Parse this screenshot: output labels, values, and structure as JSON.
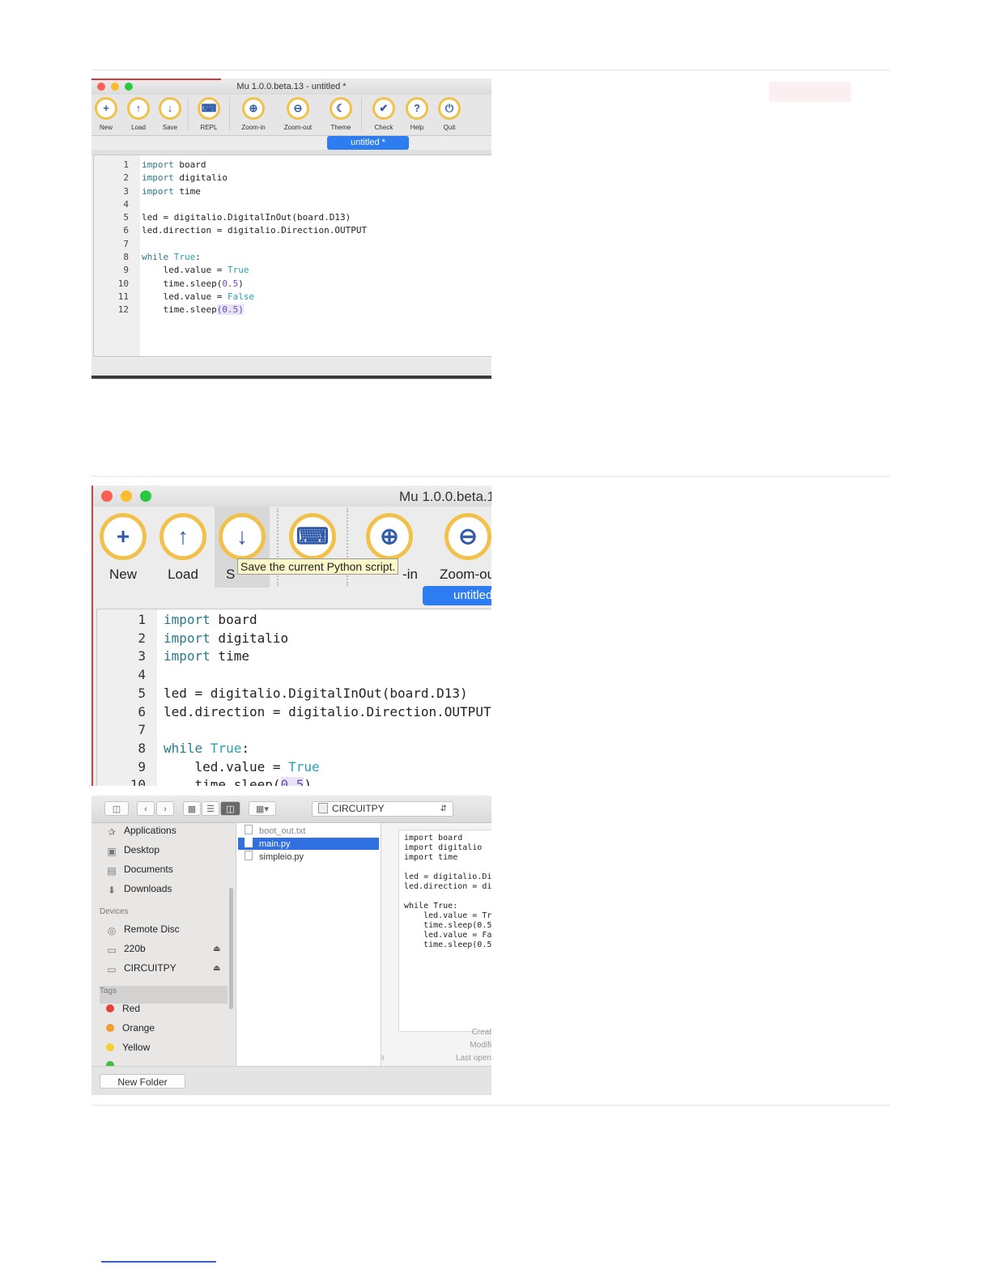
{
  "shot1": {
    "window_title": "Mu 1.0.0.beta.13 - untitled *",
    "toolbar": [
      {
        "label": "New",
        "icon": "plus-icon"
      },
      {
        "label": "Load",
        "icon": "upload-icon"
      },
      {
        "label": "Save",
        "icon": "download-icon"
      },
      {
        "label": "REPL",
        "icon": "keyboard-icon"
      },
      {
        "label": "Zoom-in",
        "icon": "zoom-in-icon"
      },
      {
        "label": "Zoom-out",
        "icon": "zoom-out-icon"
      },
      {
        "label": "Theme",
        "icon": "moon-icon"
      },
      {
        "label": "Check",
        "icon": "thumbs-up-icon"
      },
      {
        "label": "Help",
        "icon": "question-icon"
      },
      {
        "label": "Quit",
        "icon": "power-icon"
      }
    ],
    "tab": "untitled *",
    "line_numbers": [
      "1",
      "2",
      "3",
      "4",
      "5",
      "6",
      "7",
      "8",
      "9",
      "10",
      "11",
      "12"
    ],
    "code": {
      "l1a": "import",
      "l1b": " board",
      "l2a": "import",
      "l2b": " digitalio",
      "l3a": "import",
      "l3b": " time",
      "l5": "led = digitalio.DigitalInOut(board.D13)",
      "l6": "led.direction = digitalio.Direction.OUTPUT",
      "l8a": "while",
      "l8b": " True",
      "l8c": ":",
      "l9a": "    led.value = ",
      "l9b": "True",
      "l10a": "    time.sleep(",
      "l10b": "0.5",
      "l10c": ")",
      "l11a": "    led.value = ",
      "l11b": "False",
      "l12a": "    time.sleep",
      "l12b": "(0.5)"
    }
  },
  "shot2": {
    "window_title": "Mu 1.0.0.beta.13",
    "toolbar": [
      {
        "label": "New",
        "icon": "plus-icon"
      },
      {
        "label": "Load",
        "icon": "upload-icon"
      },
      {
        "label": "S",
        "icon": "download-icon"
      },
      {
        "label": "",
        "icon": "keyboard-icon"
      },
      {
        "label": "-in",
        "icon": "zoom-in-icon"
      },
      {
        "label": "Zoom-ou",
        "icon": "zoom-out-icon"
      }
    ],
    "tooltip": "Save the current Python script.",
    "tab": "untitled",
    "line_numbers": [
      "1",
      "2",
      "3",
      "4",
      "5",
      "6",
      "7",
      "8",
      "9",
      "10"
    ],
    "code": {
      "l1a": "import",
      "l1b": " board",
      "l2a": "import",
      "l2b": " digitalio",
      "l3a": "import",
      "l3b": " time",
      "l5": "led = digitalio.DigitalInOut(board.D13)",
      "l6": "led.direction = digitalio.Direction.OUTPUT",
      "l8a": "while",
      "l8b": " True",
      "l8c": ":",
      "l9a": "    led.value = ",
      "l9b": "True",
      "l10a": "    time.sleep(",
      "l10b": "0.5",
      "l10c": ")"
    }
  },
  "shot3": {
    "path": "CIRCUITPY",
    "sidebar": {
      "favorites": [
        "Applications",
        "Desktop",
        "Documents",
        "Downloads"
      ],
      "devices_header": "Devices",
      "devices": [
        "Remote Disc",
        "220b",
        "CIRCUITPY"
      ],
      "tags_header": "Tags",
      "tags": [
        {
          "name": "Red",
          "color": "#e8403a"
        },
        {
          "name": "Orange",
          "color": "#f39c2b"
        },
        {
          "name": "Yellow",
          "color": "#f5cf2e"
        }
      ]
    },
    "files": [
      "boot_out.txt",
      "main.py",
      "simpleio.py"
    ],
    "selected_file": "main.py",
    "preview_text": "import board\nimport digitalio\nimport time\n\nled = digitalio.Di\nled.direction = di\n\nwhile True:\n    led.value = Tr\n    time.sleep(0.5\n    led.value = Fa\n    time.sleep(0.5",
    "meta": [
      "Creat",
      "Modifi",
      "Last open"
    ],
    "new_folder": "New Folder"
  }
}
